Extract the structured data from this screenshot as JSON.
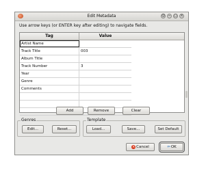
{
  "window": {
    "title": "Edit Metadata",
    "controls": [
      "☺",
      "−",
      "□",
      "×"
    ]
  },
  "instructions": "Use arrow keys (or ENTER key after editing) to navigate fields.",
  "table": {
    "headers": {
      "tag": "Tag",
      "value": "Value"
    },
    "rows": [
      {
        "tag": "Artist Name",
        "value": ""
      },
      {
        "tag": "Track Title",
        "value": "003"
      },
      {
        "tag": "Album Title",
        "value": ""
      },
      {
        "tag": "Track Number",
        "value": "3"
      },
      {
        "tag": "Year",
        "value": ""
      },
      {
        "tag": "Genre",
        "value": ""
      },
      {
        "tag": "Comments",
        "value": ""
      },
      {
        "tag": "",
        "value": ""
      },
      {
        "tag": "",
        "value": ""
      },
      {
        "tag": "",
        "value": ""
      }
    ]
  },
  "row_buttons": {
    "add": "Add",
    "remove": "Remove",
    "clear": "Clear"
  },
  "genres": {
    "label": "Genres",
    "edit": "Edit...",
    "reset": "Reset..."
  },
  "template": {
    "label": "Template",
    "load": "Load...",
    "save": "Save...",
    "set_default": "Set Default"
  },
  "dialog_buttons": {
    "cancel": "Cancel",
    "ok": "OK"
  }
}
